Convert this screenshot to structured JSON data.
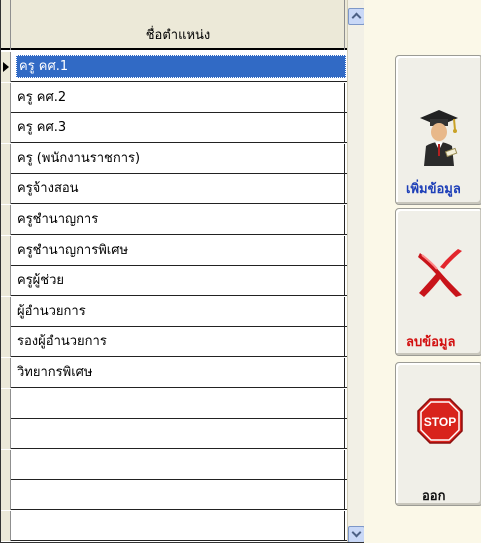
{
  "grid": {
    "column_header": "ชื่อตำแหน่ง",
    "rows": [
      {
        "label": "ครู  คศ.1",
        "selected": true
      },
      {
        "label": "ครู  คศ.2"
      },
      {
        "label": "ครู  คศ.3"
      },
      {
        "label": "ครู (พนักงานราชการ)"
      },
      {
        "label": "ครูจ้างสอน"
      },
      {
        "label": "ครูชำนาญการ"
      },
      {
        "label": "ครูชำนาญการพิเศษ"
      },
      {
        "label": "ครูผู้ช่วย"
      },
      {
        "label": "ผู้อำนวยการ"
      },
      {
        "label": "รองผู้อำนวยการ"
      },
      {
        "label": "วิทยากรพิเศษ"
      },
      {
        "label": ""
      },
      {
        "label": ""
      },
      {
        "label": ""
      },
      {
        "label": ""
      },
      {
        "label": ""
      }
    ]
  },
  "buttons": {
    "add_label": "เพิ่มข้อมูล",
    "delete_label": "ลบข้อมูล",
    "exit_label": "ออก",
    "stop_sign_text": "STOP"
  },
  "colors": {
    "selection": "#316ac5",
    "add_label": "#1d3fb8",
    "delete_label": "#d21010",
    "stop_sign": "#d8231c"
  },
  "icons": {
    "add": "graduate-icon",
    "delete": "red-x-icon",
    "exit": "stop-sign-icon"
  }
}
